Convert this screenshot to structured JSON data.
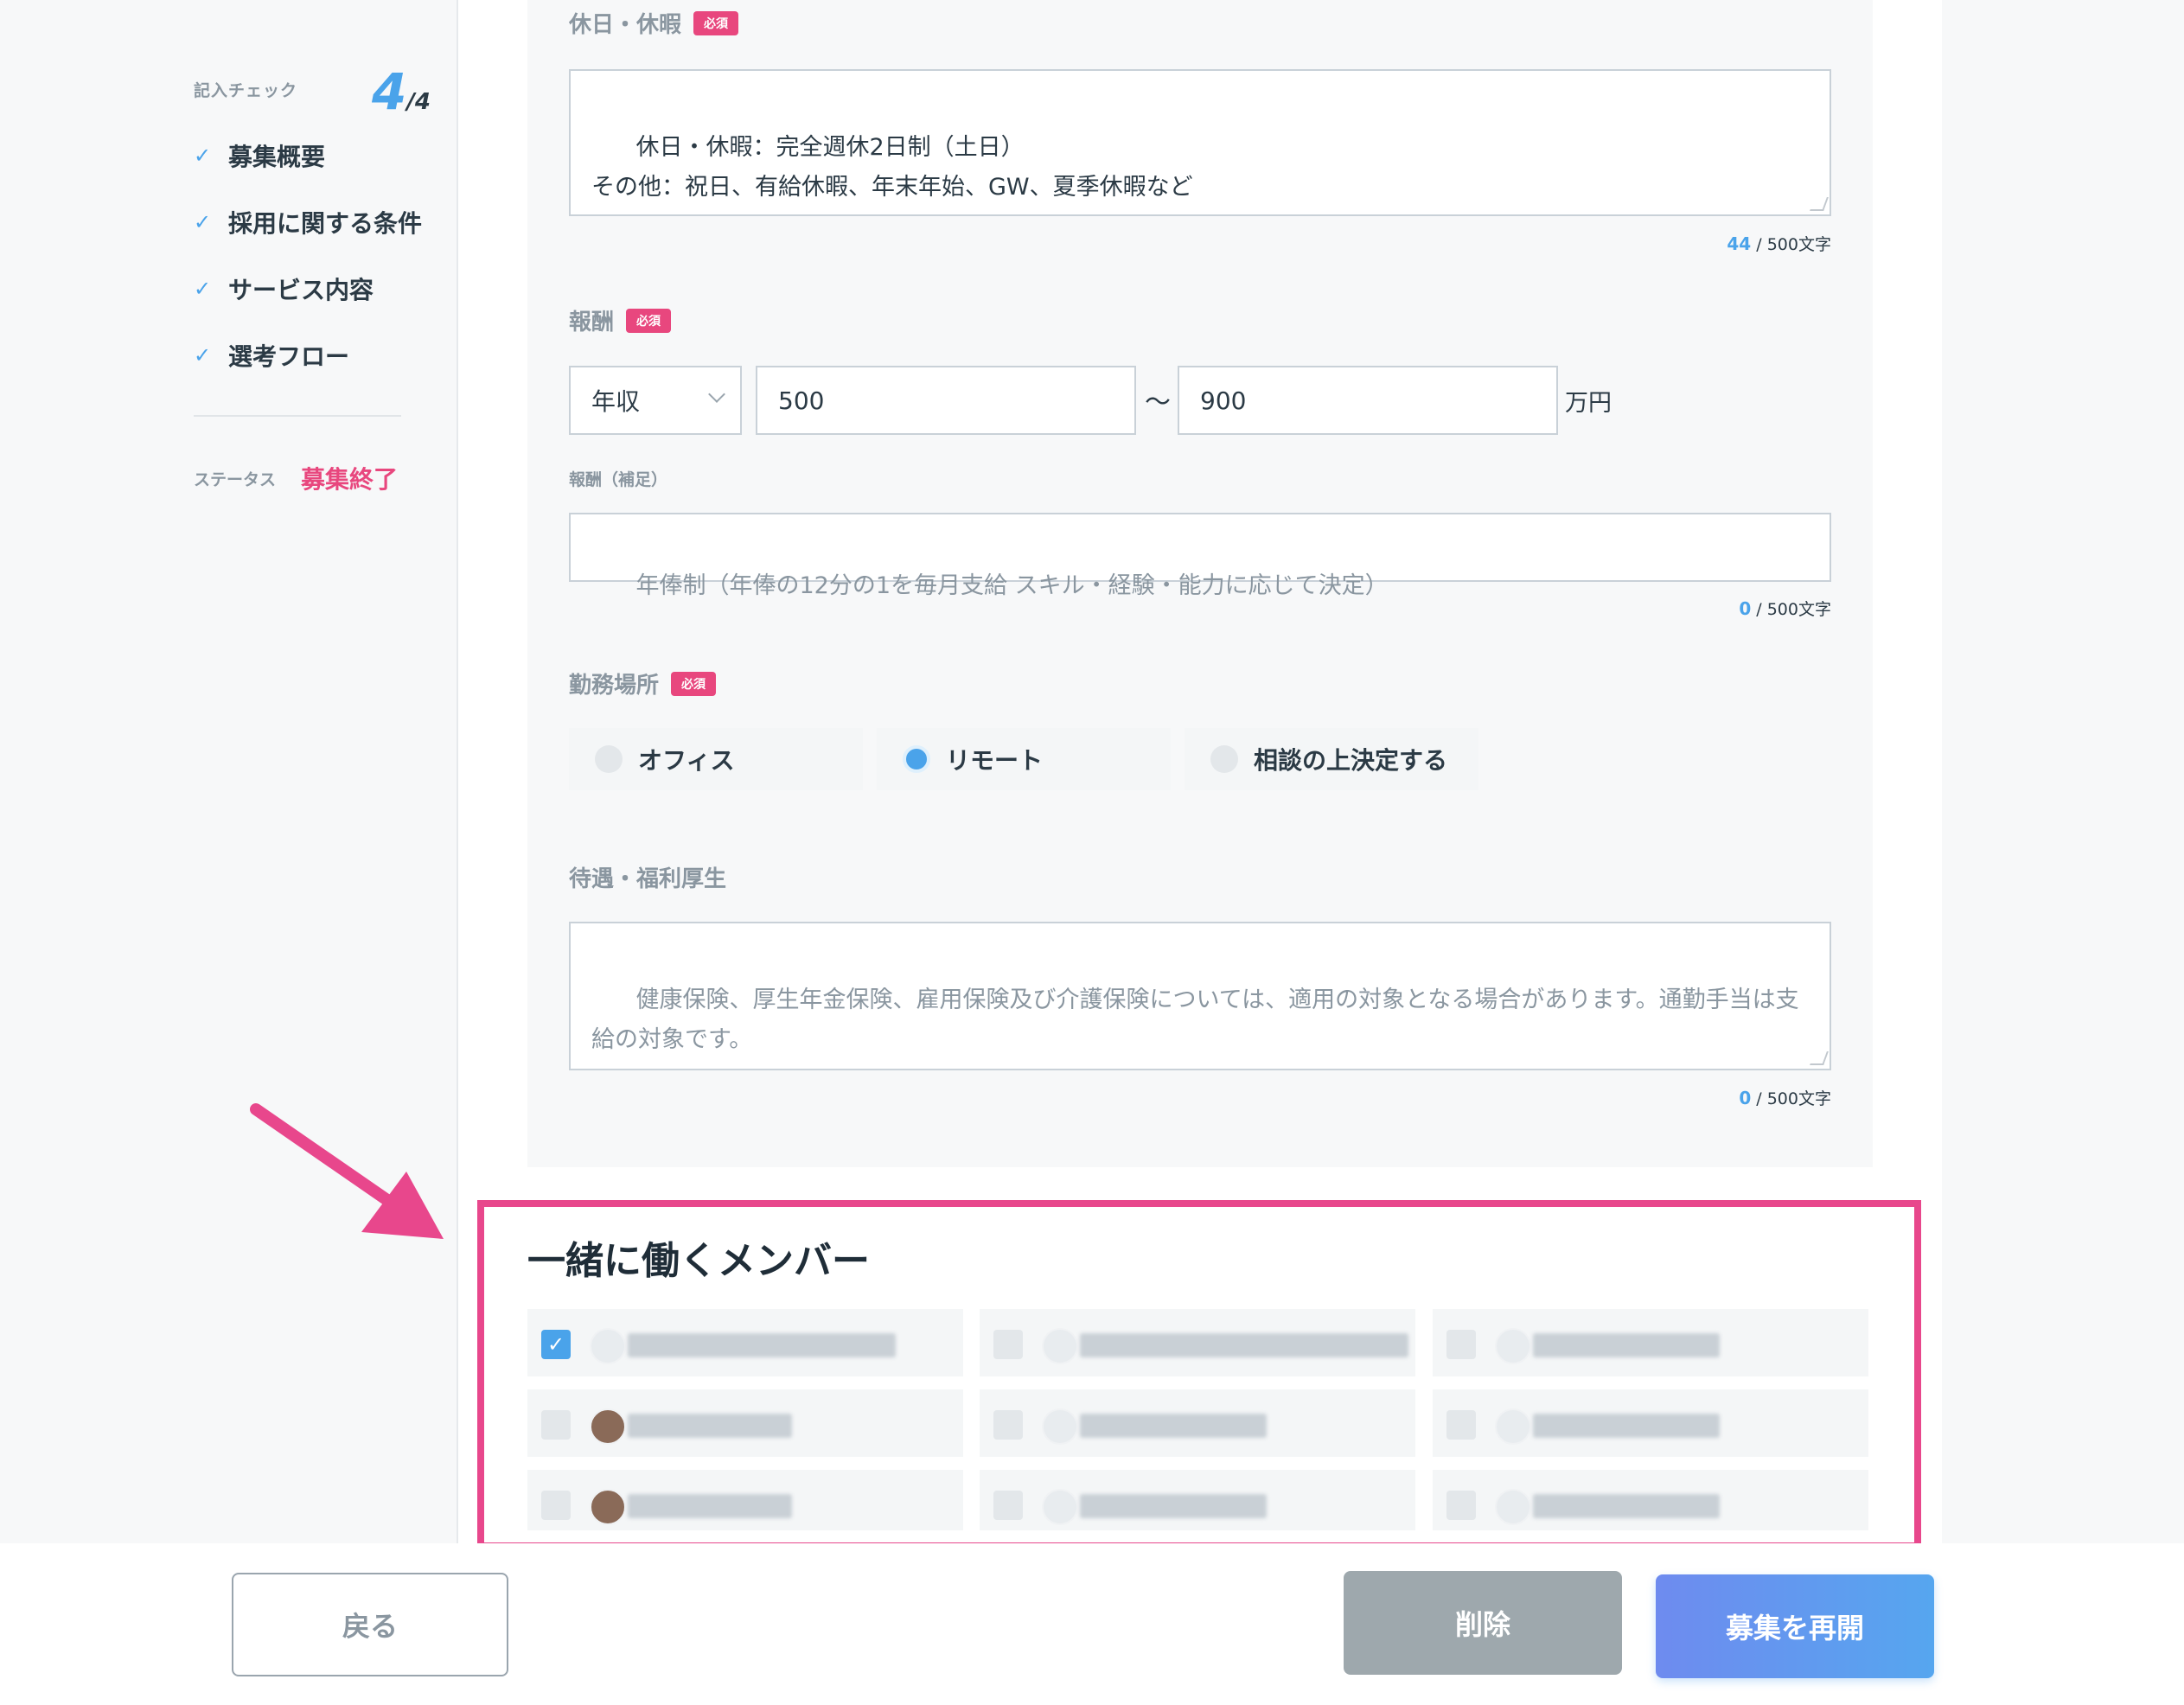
{
  "sidebar": {
    "check_label": "記入チェック",
    "check_done": "4",
    "check_total": "/4",
    "items": [
      {
        "label": "募集概要"
      },
      {
        "label": "採用に関する条件"
      },
      {
        "label": "サービス内容"
      },
      {
        "label": "選考フロー"
      }
    ],
    "status_label": "ステータス",
    "status_value": "募集終了"
  },
  "form": {
    "holidays": {
      "label": "休日・休暇",
      "required": "必須",
      "value": "休日・休暇：完全週休2日制（土日）\nその他：祝日、有給休暇、年末年始、GW、夏季休暇など",
      "count": "44",
      "limit": "/ 500文字"
    },
    "salary": {
      "label": "報酬",
      "required": "必須",
      "type": "年収",
      "min": "500",
      "separator": "〜",
      "max": "900",
      "unit": "万円"
    },
    "salary_note": {
      "label": "報酬（補足）",
      "placeholder": "年俸制（年俸の12分の1を毎月支給 スキル・経験・能力に応じて決定）",
      "count": "0",
      "limit": "/ 500文字"
    },
    "location": {
      "label": "勤務場所",
      "required": "必須",
      "options": [
        {
          "label": "オフィス",
          "selected": false
        },
        {
          "label": "リモート",
          "selected": true
        },
        {
          "label": "相談の上決定する",
          "selected": false
        }
      ]
    },
    "benefits": {
      "label": "待遇・福利厚生",
      "placeholder": "健康保険、厚生年金保険、雇用保険及び介護保険については、適用の対象となる場合があります。通勤手当は支給の対象です。",
      "count": "0",
      "limit": "/ 500文字"
    }
  },
  "members": {
    "title": "一緒に働くメンバー",
    "checked": [
      true,
      false,
      false,
      false,
      false,
      false,
      false,
      false,
      false
    ]
  },
  "footer": {
    "back_label": "戻る",
    "delete_label": "削除",
    "reopen_label": "募集を再開"
  },
  "colors": {
    "accent_blue": "#4aa3ea",
    "accent_pink": "#e8477e",
    "highlight": "#e8478c"
  }
}
